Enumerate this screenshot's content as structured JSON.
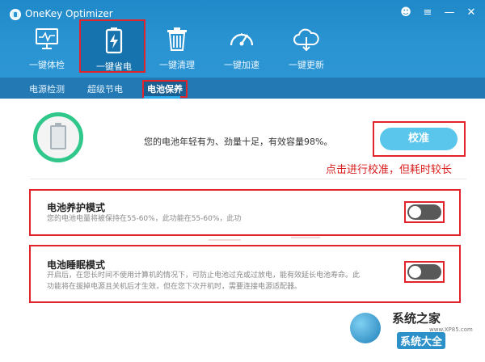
{
  "app": {
    "title": "OneKey Optimizer"
  },
  "window_controls": [
    {
      "name": "feedback-icon",
      "glyph": "☻"
    },
    {
      "name": "menu-icon",
      "glyph": "≡"
    },
    {
      "name": "minimize-icon",
      "glyph": "—"
    },
    {
      "name": "close-icon",
      "glyph": "✕"
    }
  ],
  "nav": {
    "items": [
      {
        "label": "一键体检",
        "icon": "monitor-checkup-icon"
      },
      {
        "label": "一键省电",
        "icon": "battery-save-icon",
        "active": true
      },
      {
        "label": "一键清理",
        "icon": "trash-clean-icon"
      },
      {
        "label": "一键加速",
        "icon": "speedometer-icon"
      },
      {
        "label": "一键更新",
        "icon": "cloud-update-icon"
      }
    ]
  },
  "subtabs": [
    {
      "label": "电源检测"
    },
    {
      "label": "超级节电"
    },
    {
      "label": "电池保养",
      "active": true
    }
  ],
  "battery": {
    "status_text": "您的电池年轻有为、劲量十足，有效容量98%。",
    "calibrate_label": "校准",
    "annotation": "点击进行校准，但耗时较长"
  },
  "modes": [
    {
      "title": "电池养护模式",
      "desc": "您的电池电量将被保持在55-60%，此功能在55-60%，此功",
      "enabled": false
    },
    {
      "title": "电池睡眠模式",
      "desc_line1": "开启后，在您长时间不使用计算机的情况下，可防止电池过充或过放电，能有效延长电池寿命。此",
      "desc_line2": "功能将在拔掉电源且关机后才生效，但在您下次开机时，需要连接电源适配器。",
      "enabled": false
    }
  ],
  "watermark": {
    "text1": "系统之家",
    "text2": "系统大全",
    "url": "www.XP85.com"
  },
  "colors": {
    "header": "#2a93d1",
    "subtab_bar": "#2279b4",
    "highlight_red": "#e0242a",
    "calibrate_button": "#5bc6ec",
    "battery_ring": "#2fc88a",
    "toggle_off": "#585858"
  }
}
